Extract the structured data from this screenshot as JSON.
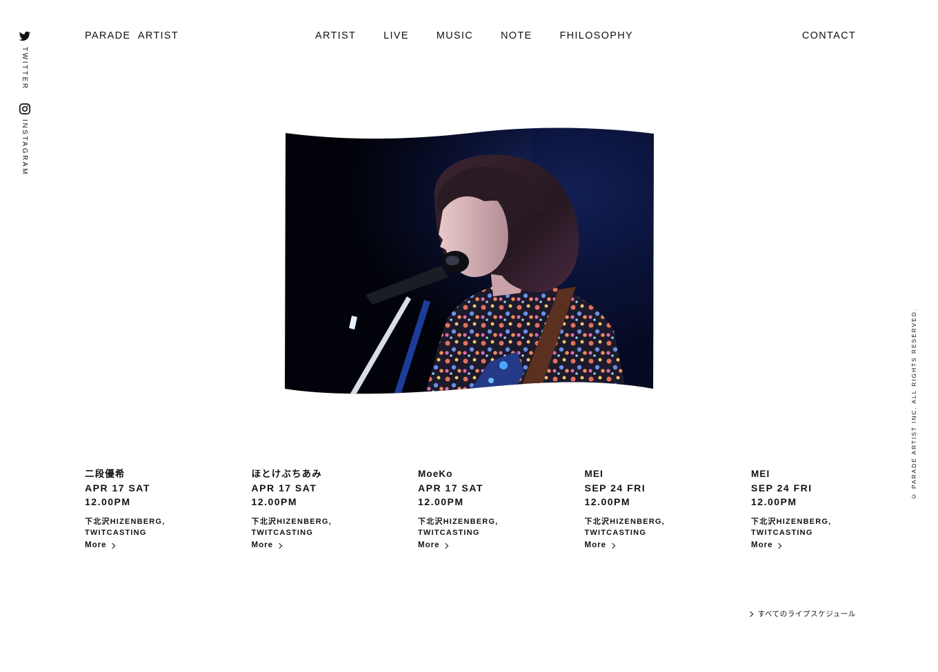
{
  "social": {
    "twitter_label": "TWITTER",
    "instagram_label": "INSTAGRAM",
    "twitter_icon": "twitter-bird-icon",
    "instagram_icon": "instagram-camera-icon"
  },
  "header": {
    "brand": "PARADE ARTIST",
    "nav": [
      "ARTIST",
      "LIVE",
      "MUSIC",
      "NOTE",
      "FHILOSOPHY"
    ],
    "contact": "CONTACT"
  },
  "hero": {
    "image": "photo of a singer with short hair performing at a microphone stand with a guitar strap, dark stage background, floral blouse"
  },
  "lives": [
    {
      "artist": "二段優希",
      "date": "APR 17 SAT",
      "time": "12.00PM",
      "venue_line1": "下北沢HIZENBERG,",
      "venue_line2": "TWITCASTING",
      "more": "More"
    },
    {
      "artist": "ほとけぶちあみ",
      "date": "APR 17 SAT",
      "time": "12.00PM",
      "venue_line1": "下北沢HIZENBERG,",
      "venue_line2": "TWITCASTING",
      "more": "More"
    },
    {
      "artist": "MoeKo",
      "date": "APR 17 SAT",
      "time": "12.00PM",
      "venue_line1": "下北沢HIZENBERG,",
      "venue_line2": "TWITCASTING",
      "more": "More"
    },
    {
      "artist": "MEI",
      "date": "SEP 24 FRI",
      "time": "12.00PM",
      "venue_line1": "下北沢HIZENBERG,",
      "venue_line2": "TWITCASTING",
      "more": "More"
    },
    {
      "artist": "MEI",
      "date": "SEP 24 FRI",
      "time": "12.00PM",
      "venue_line1": "下北沢HIZENBERG,",
      "venue_line2": "TWITCASTING",
      "more": "More"
    }
  ],
  "all_schedule": "すべてのライブスケジュール",
  "copyright": "© PARADE ARTIST INC. ALL RIGHTS RESERVED."
}
